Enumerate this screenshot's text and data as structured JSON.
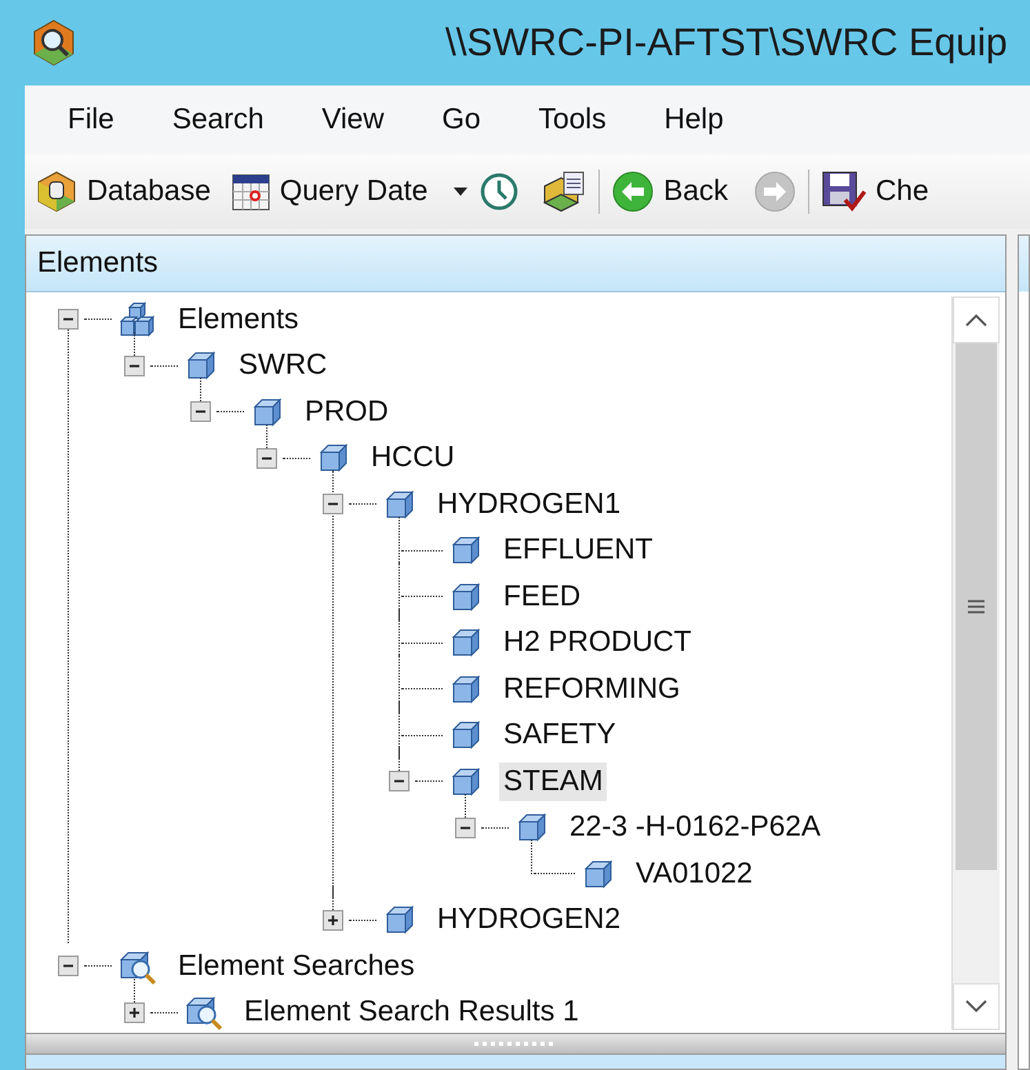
{
  "window": {
    "title": "\\\\SWRC-PI-AFTST\\SWRC Equip"
  },
  "menu": [
    "File",
    "Search",
    "View",
    "Go",
    "Tools",
    "Help"
  ],
  "toolbar": {
    "database_button": {
      "label": "Database"
    },
    "query_date_button": {
      "label": "Query Date"
    },
    "back_button": {
      "label": "Back",
      "disabled": false
    },
    "forward_button": {
      "disabled": true
    },
    "check_button": {
      "label": "Che"
    }
  },
  "elements_panel": {
    "title": "Elements",
    "tree": [
      {
        "label": "Elements",
        "kind": "group",
        "expanded": true,
        "selected": false,
        "children": [
          {
            "label": "SWRC",
            "kind": "element",
            "expanded": true,
            "selected": false,
            "children": [
              {
                "label": "PROD",
                "kind": "element",
                "expanded": true,
                "selected": false,
                "children": [
                  {
                    "label": "HCCU",
                    "kind": "element",
                    "expanded": true,
                    "selected": false,
                    "children": [
                      {
                        "label": "HYDROGEN1",
                        "kind": "element",
                        "expanded": true,
                        "selected": false,
                        "children": [
                          {
                            "label": "EFFLUENT",
                            "kind": "element",
                            "selected": false
                          },
                          {
                            "label": "FEED",
                            "kind": "element",
                            "selected": false
                          },
                          {
                            "label": "H2 PRODUCT",
                            "kind": "element",
                            "selected": false
                          },
                          {
                            "label": "REFORMING",
                            "kind": "element",
                            "selected": false
                          },
                          {
                            "label": "SAFETY",
                            "kind": "element",
                            "selected": false
                          },
                          {
                            "label": "STEAM",
                            "kind": "element",
                            "expanded": true,
                            "selected": true,
                            "children": [
                              {
                                "label": "22-3 -H-0162-P62A",
                                "kind": "element",
                                "expanded": true,
                                "selected": false,
                                "children": [
                                  {
                                    "label": "VA01022",
                                    "kind": "element",
                                    "selected": false
                                  }
                                ]
                              }
                            ]
                          }
                        ]
                      },
                      {
                        "label": "HYDROGEN2",
                        "kind": "element",
                        "expanded": false,
                        "selected": false
                      }
                    ]
                  }
                ]
              }
            ]
          }
        ]
      },
      {
        "label": "Element Searches",
        "kind": "search",
        "expanded": true,
        "selected": false,
        "children": [
          {
            "label": "Element Search Results 1",
            "kind": "search",
            "expanded": false,
            "selected": false
          }
        ]
      }
    ]
  }
}
